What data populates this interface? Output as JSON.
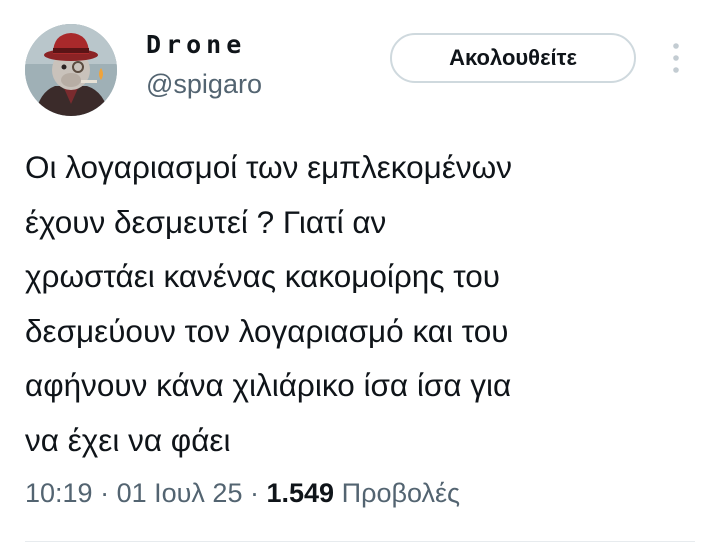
{
  "author": {
    "display_name": "Drone",
    "handle": "@spigaro",
    "avatar_icon": "avatar-character-red-hat-monocle"
  },
  "follow_button_label": "Ακολουθείτε",
  "more_icon": "more-vertical-icon",
  "tweet": {
    "text": "Οι λογαριασμοί των εμπλεκομένων\nέχουν δεσμευτεί ? Γιατί αν\nχρωστάει κανένας κακομοίρης του\nδεσμεύουν τον λογαριασμό και του\nαφήνουν κάνα χιλιάρικο ίσα ίσα για\nνα έχει να φάει",
    "time": "10:19",
    "separator": "·",
    "date": "01 Ιουλ 25",
    "views_count": "1.549",
    "views_label": "Προβολές"
  },
  "colors": {
    "text_primary": "#0f1419",
    "text_secondary": "#536471",
    "button_border": "#cfd9de",
    "divider": "#e7ebee"
  }
}
